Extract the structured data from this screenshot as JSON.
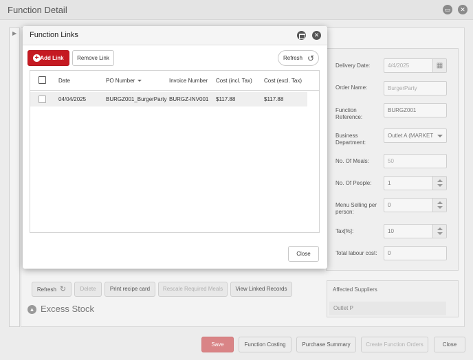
{
  "background": {
    "title": "Function Detail",
    "form": {
      "delivery_date": {
        "label": "Delivery Date:",
        "value": "4/4/2025"
      },
      "order_name": {
        "label": "Order Name:",
        "value": "BurgerParty"
      },
      "function_reference": {
        "label": "Function Reference:",
        "value": "BURGZ001"
      },
      "business_department": {
        "label": "Business Department:",
        "value": "Outlet A (MARKET"
      },
      "no_of_meals": {
        "label": "No. Of Meals:",
        "value": "50"
      },
      "no_of_people": {
        "label": "No. Of People:",
        "value": "1"
      },
      "menu_selling_per_person": {
        "label": "Menu Selling per person:",
        "value": "0"
      },
      "tax": {
        "label": "Tax[%]:",
        "value": "10"
      },
      "total_labour_cost": {
        "label": "Total labour cost:",
        "value": "0"
      }
    },
    "toolbar": {
      "refresh": "Refresh",
      "delete": "Delete",
      "print_recipe_card": "Print recipe card",
      "rescale_required_meals": "Rescale Required Meals",
      "view_linked_records": "View Linked Records"
    },
    "excess_stock": "Excess Stock",
    "affected_suppliers": {
      "header": "Affected Suppliers",
      "items": [
        "Outlet P"
      ]
    },
    "footer": {
      "save": "Save",
      "function_costing": "Function Costing",
      "purchase_summary": "Purchase Summary",
      "create_function_orders": "Create Function Orders",
      "close": "Close"
    }
  },
  "modal": {
    "title": "Function Links",
    "add_link": "Add Link",
    "remove_link": "Remove Link",
    "refresh": "Refresh",
    "columns": [
      "Date",
      "PO Number",
      "Invoice Number",
      "Cost (incl. Tax)",
      "Cost (excl. Tax)"
    ],
    "rows": [
      {
        "date": "04/04/2025",
        "po_number": "BURGZ001_BurgerParty",
        "invoice_number": "BURGZ-INV001",
        "cost_incl": "$117.88",
        "cost_excl": "$117.88"
      }
    ],
    "close": "Close"
  },
  "colors": {
    "accent": "#c51a22",
    "save_button": "#d98486"
  },
  "icons": [
    "minimize-icon",
    "close-icon",
    "plus-icon",
    "refresh-icon",
    "calendar-icon",
    "sort-down-icon",
    "collapse-icon",
    "expand-arrow-icon"
  ]
}
